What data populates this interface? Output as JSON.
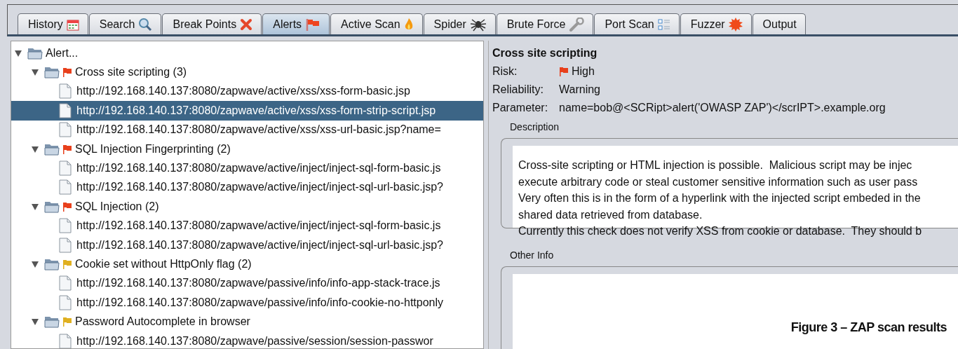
{
  "tabs": [
    {
      "label": "History",
      "selected": false
    },
    {
      "label": "Search",
      "selected": false
    },
    {
      "label": "Break Points",
      "selected": false
    },
    {
      "label": "Alerts",
      "selected": true
    },
    {
      "label": "Active Scan",
      "selected": false
    },
    {
      "label": "Spider",
      "selected": false
    },
    {
      "label": "Brute Force",
      "selected": false
    },
    {
      "label": "Port Scan",
      "selected": false
    },
    {
      "label": "Fuzzer",
      "selected": false
    },
    {
      "label": "Output",
      "selected": false
    }
  ],
  "tree": {
    "label": "Alert...",
    "expanded": true,
    "children": [
      {
        "label": "Cross site scripting (3)",
        "color": "#e8401c",
        "expanded": true,
        "children": [
          {
            "label": "http://192.168.140.137:8080/zapwave/active/xss/xss-form-basic.jsp",
            "selected": false
          },
          {
            "label": "http://192.168.140.137:8080/zapwave/active/xss/xss-form-strip-script.jsp",
            "selected": true
          },
          {
            "label": "http://192.168.140.137:8080/zapwave/active/xss/xss-url-basic.jsp?name=",
            "selected": false
          }
        ]
      },
      {
        "label": "SQL Injection Fingerprinting (2)",
        "color": "#e8401c",
        "expanded": true,
        "children": [
          {
            "label": "http://192.168.140.137:8080/zapwave/active/inject/inject-sql-form-basic.js",
            "selected": false
          },
          {
            "label": "http://192.168.140.137:8080/zapwave/active/inject/inject-sql-url-basic.jsp?",
            "selected": false
          }
        ]
      },
      {
        "label": "SQL Injection (2)",
        "color": "#e8401c",
        "expanded": true,
        "children": [
          {
            "label": "http://192.168.140.137:8080/zapwave/active/inject/inject-sql-form-basic.js",
            "selected": false
          },
          {
            "label": "http://192.168.140.137:8080/zapwave/active/inject/inject-sql-url-basic.jsp?",
            "selected": false
          }
        ]
      },
      {
        "label": "Cookie set without HttpOnly flag (2)",
        "color": "#e0b020",
        "expanded": true,
        "children": [
          {
            "label": "http://192.168.140.137:8080/zapwave/passive/info/info-app-stack-trace.js",
            "selected": false
          },
          {
            "label": "http://192.168.140.137:8080/zapwave/passive/info/info-cookie-no-httponly",
            "selected": false
          }
        ]
      },
      {
        "label": "Password Autocomplete in browser",
        "color": "#e0b020",
        "expanded": true,
        "children": [
          {
            "label": "http://192.168.140.137:8080/zapwave/passive/session/session-passwor",
            "selected": false
          }
        ]
      }
    ]
  },
  "details": {
    "title": "Cross site scripting",
    "fields": [
      {
        "label": "Risk:",
        "value": "High",
        "color": "#e8401c"
      },
      {
        "label": "Reliability:",
        "value": "Warning"
      },
      {
        "label": "Parameter:",
        "value": "name=bob@<SCRipt>alert('OWASP ZAP')</scrIPT>.example.org"
      }
    ],
    "description": {
      "heading": "Description",
      "lines": [
        "Cross-site scripting or HTML injection is possible.  Malicious script may be injec",
        "execute arbitrary code or steal customer sensitive information such as user pass",
        "Very often this is in the form of a hyperlink with the injected script embeded in the",
        "shared data retrieved from database.",
        "Currently this check does not verify XSS from cookie or database.  They should b"
      ]
    },
    "other_info": {
      "heading": "Other Info"
    }
  },
  "caption": "Figure 3 – ZAP scan results"
}
